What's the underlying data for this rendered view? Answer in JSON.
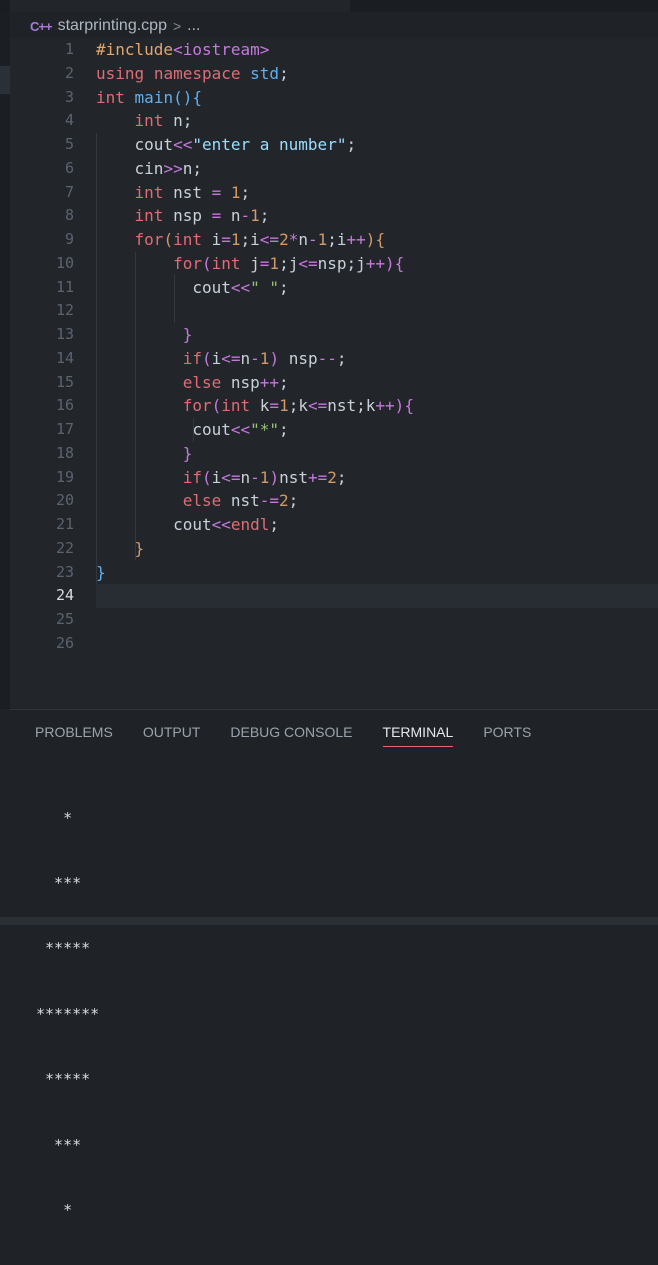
{
  "breadcrumb": {
    "icon": "cpp-file-icon",
    "icon_text": "C++",
    "file": "starprinting.cpp",
    "sep": ">",
    "more": "..."
  },
  "editor": {
    "active_line": 24,
    "line_numbers": [
      "1",
      "2",
      "3",
      "4",
      "5",
      "6",
      "7",
      "8",
      "9",
      "10",
      "11",
      "12",
      "13",
      "14",
      "15",
      "16",
      "17",
      "18",
      "19",
      "20",
      "21",
      "22",
      "23",
      "24",
      "25",
      "26"
    ]
  },
  "panel": {
    "tabs": [
      {
        "label": "PROBLEMS"
      },
      {
        "label": "OUTPUT"
      },
      {
        "label": "DEBUG CONSOLE"
      },
      {
        "label": "TERMINAL",
        "active": true
      },
      {
        "label": "PORTS"
      }
    ],
    "terminal_lines": [
      "   *",
      "  ***",
      " *****",
      "*******",
      " *****",
      "  ***",
      "   *"
    ]
  },
  "colors": {
    "keyword": "#e06c75",
    "number": "#d19a66",
    "string": "#98c379",
    "function": "#61afef",
    "operator": "#c678dd",
    "active_tab_underline": "#e06c75"
  }
}
